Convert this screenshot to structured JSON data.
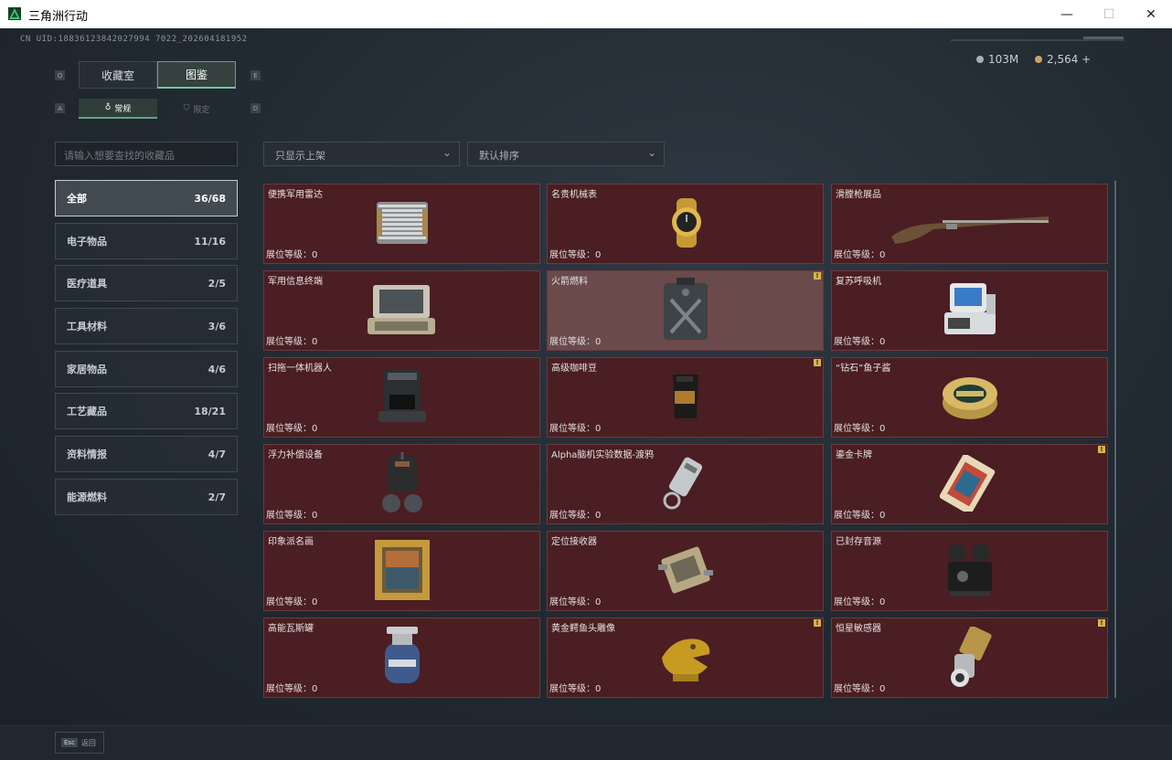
{
  "window": {
    "title": "三角洲行动"
  },
  "header": {
    "uid": "CN UID:18836123842027994 7022_202604181952",
    "currency1": "103M",
    "currency2": "2,564 +"
  },
  "tabs": {
    "left_key": "Q",
    "right_key": "E",
    "items": [
      {
        "label": "收藏室"
      },
      {
        "label": "图鉴"
      }
    ],
    "sub_left_key": "A",
    "sub_right_key": "D",
    "subitems": [
      {
        "label": "常规"
      },
      {
        "label": "限定"
      }
    ]
  },
  "search": {
    "placeholder": "请输入想要查找的收藏品"
  },
  "filters": {
    "shelf": "只显示上架",
    "sort": "默认排序"
  },
  "categories": [
    {
      "label": "全部",
      "count": "36/68"
    },
    {
      "label": "电子物品",
      "count": "11/16"
    },
    {
      "label": "医疗道具",
      "count": "2/5"
    },
    {
      "label": "工具材料",
      "count": "3/6"
    },
    {
      "label": "家居物品",
      "count": "4/6"
    },
    {
      "label": "工艺藏品",
      "count": "18/21"
    },
    {
      "label": "资料情报",
      "count": "4/7"
    },
    {
      "label": "能源燃料",
      "count": "2/7"
    }
  ],
  "level_label": "展位等级：0",
  "items": [
    {
      "name": "便携军用雷达",
      "badge": false,
      "icon": "radar-icon"
    },
    {
      "name": "名贵机械表",
      "badge": false,
      "icon": "watch-icon"
    },
    {
      "name": "滑膛枪展品",
      "badge": false,
      "icon": "musket-icon"
    },
    {
      "name": "军用信息终端",
      "badge": false,
      "icon": "terminal-icon"
    },
    {
      "name": "火箭燃料",
      "badge": true,
      "icon": "fuel-can-icon"
    },
    {
      "name": "复苏呼吸机",
      "badge": false,
      "icon": "ventilator-icon"
    },
    {
      "name": "扫拖一体机器人",
      "badge": false,
      "icon": "robot-vacuum-icon"
    },
    {
      "name": "高级咖啡豆",
      "badge": true,
      "icon": "coffee-bag-icon"
    },
    {
      "name": "“钻石”鱼子酱",
      "badge": false,
      "icon": "caviar-tin-icon"
    },
    {
      "name": "浮力补偿设备",
      "badge": false,
      "icon": "bcd-icon"
    },
    {
      "name": "Alpha脑机实验数据-渡鸦",
      "badge": false,
      "icon": "data-drive-icon"
    },
    {
      "name": "鎏金卡牌",
      "badge": true,
      "icon": "card-icon"
    },
    {
      "name": "印象派名画",
      "badge": false,
      "icon": "painting-icon"
    },
    {
      "name": "定位接收器",
      "badge": false,
      "icon": "receiver-icon"
    },
    {
      "name": "已封存音源",
      "badge": false,
      "icon": "projector-icon"
    },
    {
      "name": "高能瓦斯罐",
      "badge": false,
      "icon": "gas-tank-icon"
    },
    {
      "name": "黄金鳄鱼头雕像",
      "badge": true,
      "icon": "croc-statue-icon"
    },
    {
      "name": "恒星敏感器",
      "badge": true,
      "icon": "star-sensor-icon"
    }
  ],
  "bottom": {
    "esc_key": "Esc",
    "esc_label": "返回"
  }
}
